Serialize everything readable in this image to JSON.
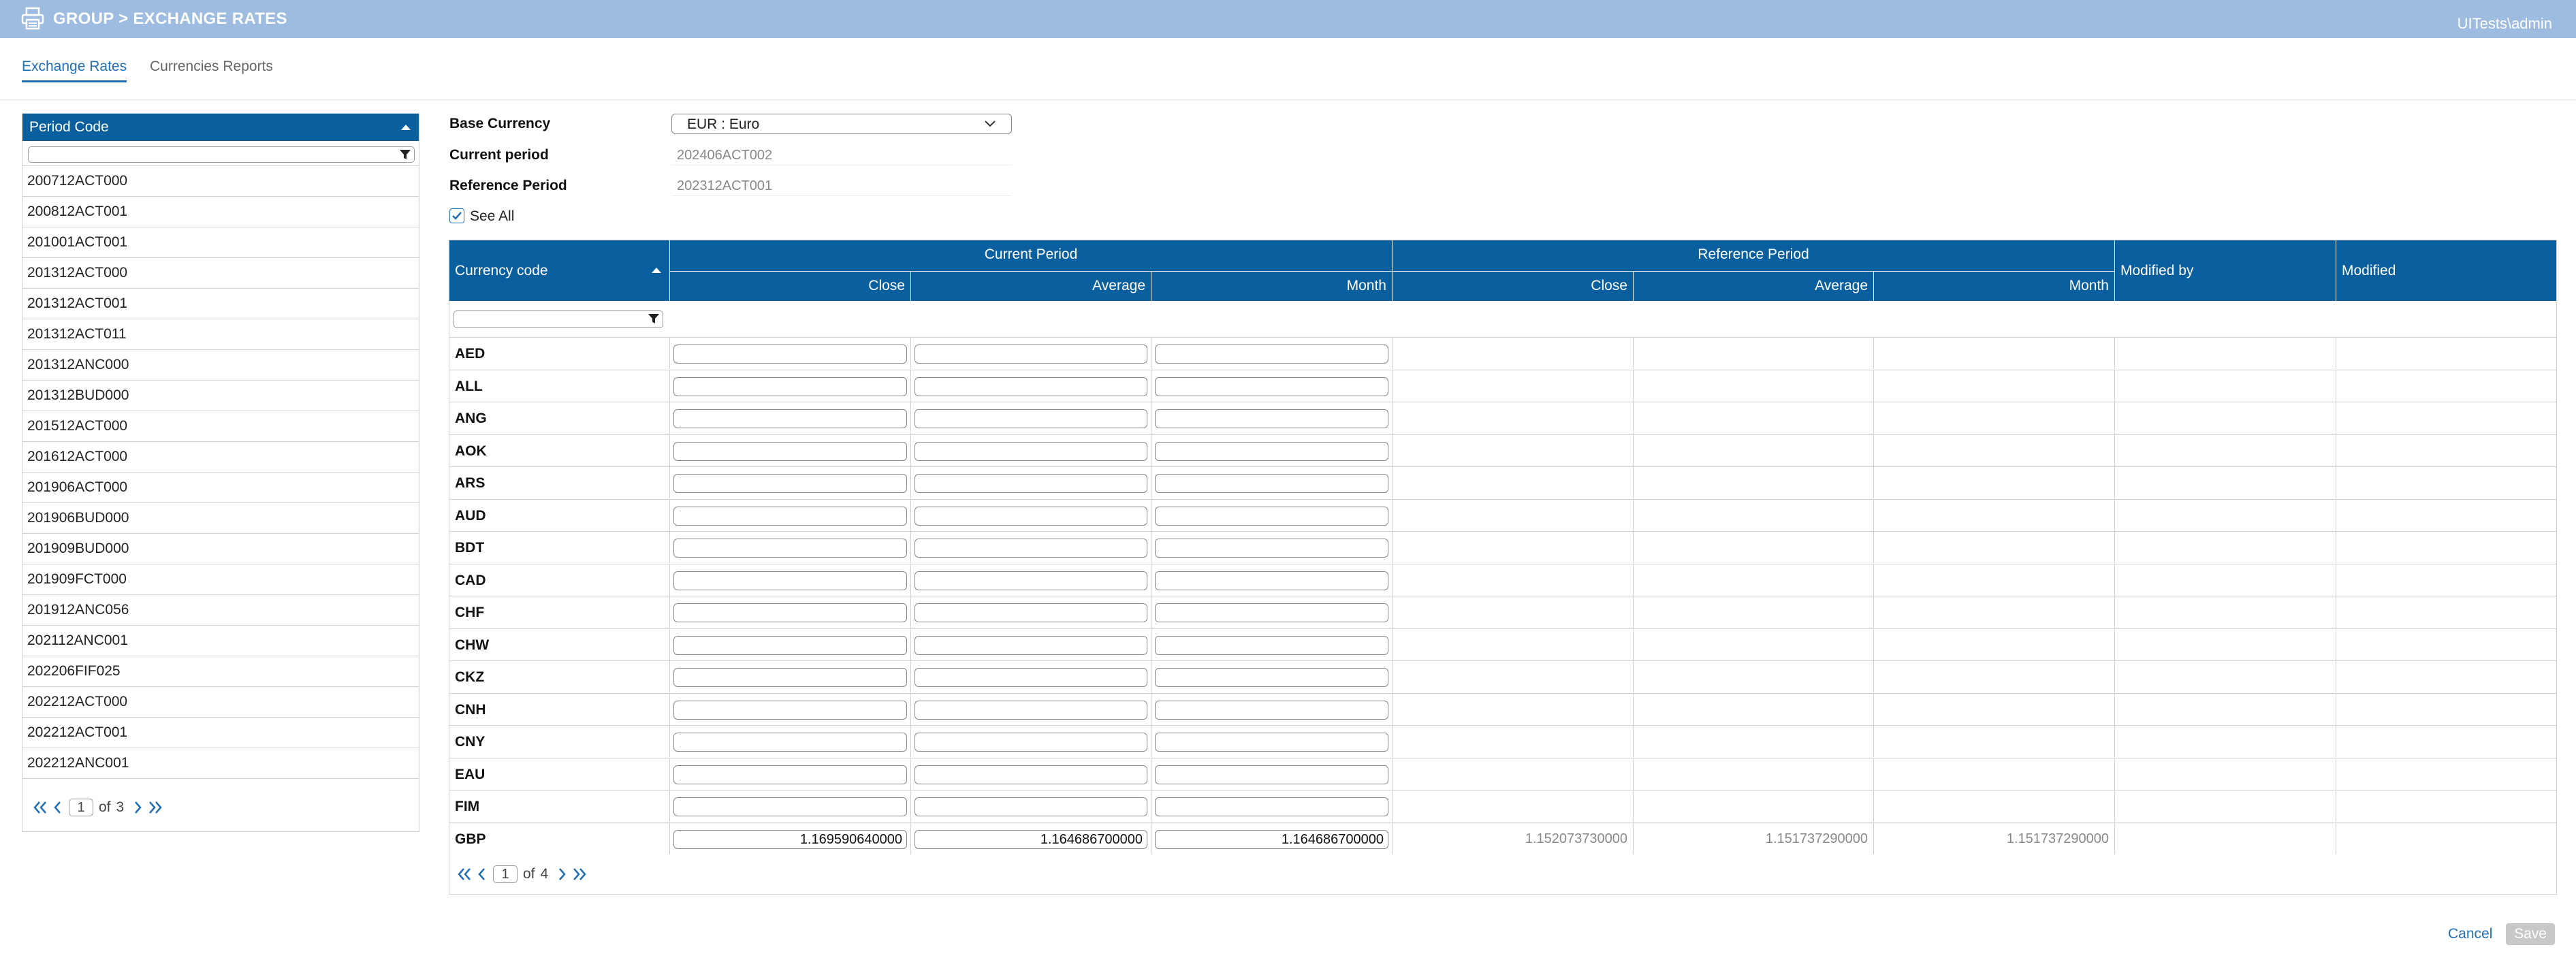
{
  "header": {
    "icon": "printer-icon",
    "title": "GROUP > EXCHANGE RATES",
    "user": "UITests\\admin",
    "color": "#9dbce0"
  },
  "tabs": [
    {
      "label": "Exchange Rates",
      "active": true
    },
    {
      "label": "Currencies Reports",
      "active": false
    }
  ],
  "period_list": {
    "header": "Period Code",
    "filter_value": "",
    "items": [
      "200712ACT000",
      "200812ACT001",
      "201001ACT001",
      "201312ACT000",
      "201312ACT001",
      "201312ACT011",
      "201312ANC000",
      "201312BUD000",
      "201512ACT000",
      "201612ACT000",
      "201906ACT000",
      "201906BUD000",
      "201909BUD000",
      "201909FCT000",
      "201912ANC056",
      "202112ANC001",
      "202206FIF025",
      "202212ACT000",
      "202212ACT001",
      "202212ANC001"
    ],
    "pager": {
      "page": "1",
      "of_label": "of",
      "total": "3"
    }
  },
  "form": {
    "base_currency_label": "Base Currency",
    "base_currency_value": "EUR : Euro",
    "current_period_label": "Current period",
    "current_period_value": "202406ACT002",
    "reference_period_label": "Reference Period",
    "reference_period_value": "202312ACT001",
    "see_all_label": "See All",
    "see_all_checked": true
  },
  "grid": {
    "col_currency": "Currency code",
    "group_current": "Current Period",
    "group_reference": "Reference Period",
    "col_close": "Close",
    "col_average": "Average",
    "col_month": "Month",
    "col_modified_by": "Modified by",
    "col_modified": "Modified",
    "rows": [
      {
        "code": "AED",
        "cur_close": "",
        "cur_avg": "",
        "cur_month": "",
        "ref_close": "",
        "ref_avg": "",
        "ref_month": ""
      },
      {
        "code": "ALL",
        "cur_close": "",
        "cur_avg": "",
        "cur_month": "",
        "ref_close": "",
        "ref_avg": "",
        "ref_month": ""
      },
      {
        "code": "ANG",
        "cur_close": "",
        "cur_avg": "",
        "cur_month": "",
        "ref_close": "",
        "ref_avg": "",
        "ref_month": ""
      },
      {
        "code": "AOK",
        "cur_close": "",
        "cur_avg": "",
        "cur_month": "",
        "ref_close": "",
        "ref_avg": "",
        "ref_month": ""
      },
      {
        "code": "ARS",
        "cur_close": "",
        "cur_avg": "",
        "cur_month": "",
        "ref_close": "",
        "ref_avg": "",
        "ref_month": ""
      },
      {
        "code": "AUD",
        "cur_close": "",
        "cur_avg": "",
        "cur_month": "",
        "ref_close": "",
        "ref_avg": "",
        "ref_month": ""
      },
      {
        "code": "BDT",
        "cur_close": "",
        "cur_avg": "",
        "cur_month": "",
        "ref_close": "",
        "ref_avg": "",
        "ref_month": ""
      },
      {
        "code": "CAD",
        "cur_close": "",
        "cur_avg": "",
        "cur_month": "",
        "ref_close": "",
        "ref_avg": "",
        "ref_month": ""
      },
      {
        "code": "CHF",
        "cur_close": "",
        "cur_avg": "",
        "cur_month": "",
        "ref_close": "",
        "ref_avg": "",
        "ref_month": ""
      },
      {
        "code": "CHW",
        "cur_close": "",
        "cur_avg": "",
        "cur_month": "",
        "ref_close": "",
        "ref_avg": "",
        "ref_month": ""
      },
      {
        "code": "CKZ",
        "cur_close": "",
        "cur_avg": "",
        "cur_month": "",
        "ref_close": "",
        "ref_avg": "",
        "ref_month": ""
      },
      {
        "code": "CNH",
        "cur_close": "",
        "cur_avg": "",
        "cur_month": "",
        "ref_close": "",
        "ref_avg": "",
        "ref_month": ""
      },
      {
        "code": "CNY",
        "cur_close": "",
        "cur_avg": "",
        "cur_month": "",
        "ref_close": "",
        "ref_avg": "",
        "ref_month": ""
      },
      {
        "code": "EAU",
        "cur_close": "",
        "cur_avg": "",
        "cur_month": "",
        "ref_close": "",
        "ref_avg": "",
        "ref_month": ""
      },
      {
        "code": "FIM",
        "cur_close": "",
        "cur_avg": "",
        "cur_month": "",
        "ref_close": "",
        "ref_avg": "",
        "ref_month": ""
      },
      {
        "code": "GBP",
        "cur_close": "1.169590640000",
        "cur_avg": "1.164686700000",
        "cur_month": "1.164686700000",
        "ref_close": "1.152073730000",
        "ref_avg": "1.151737290000",
        "ref_month": "1.151737290000"
      }
    ],
    "pager": {
      "page": "1",
      "of_label": "of",
      "total": "4"
    }
  },
  "footer": {
    "cancel_label": "Cancel",
    "save_label": "Save"
  },
  "colors": {
    "accent": "#1f6fb6",
    "header_bg": "#0a5f9f",
    "save_disabled": "#c8c8c8"
  }
}
